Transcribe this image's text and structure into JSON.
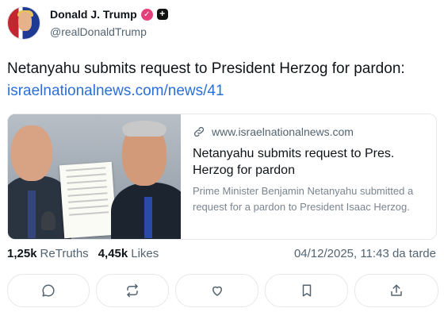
{
  "author": {
    "display_name": "Donald J. Trump",
    "handle": "@realDonaldTrump",
    "verified_icon": "verified-badge-icon",
    "plus_icon": "plus-badge-icon"
  },
  "post": {
    "text": "Netanyahu submits request to President Herzog for pardon:",
    "link": "israelnationalnews.com/news/41"
  },
  "link_card": {
    "domain": "www.israelnationalnews.com",
    "title": "Netanyahu submits request to Pres. Herzog for pardon",
    "description": "Prime Minister Benjamin Netanyahu submitted a request for a pardon to President Isaac Herzog."
  },
  "stats": {
    "retruths_count": "1,25k",
    "retruths_label": "ReTruths",
    "likes_count": "4,45k",
    "likes_label": "Likes",
    "timestamp": "04/12/2025, 11:43 da tarde"
  },
  "actions": [
    "reply-icon",
    "retruth-icon",
    "like-icon",
    "bookmark-icon",
    "share-icon"
  ],
  "colors": {
    "link": "#2b6fd6",
    "verified_badge": "#e3407a",
    "muted_text": "#536471",
    "border": "#e5e8eb"
  }
}
